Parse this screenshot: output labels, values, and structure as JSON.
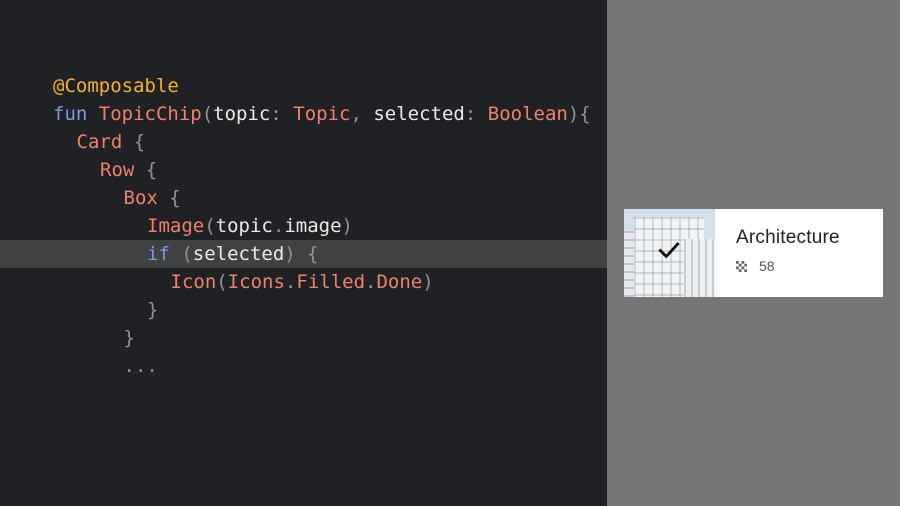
{
  "code": {
    "lines": [
      {
        "indent": 0,
        "tokens": [
          {
            "t": "@Composable",
            "c": "ann"
          }
        ]
      },
      {
        "indent": 0,
        "tokens": [
          {
            "t": "fun ",
            "c": "kw"
          },
          {
            "t": "TopicChip",
            "c": "fn"
          },
          {
            "t": "(",
            "c": "punc"
          },
          {
            "t": "topic",
            "c": "id"
          },
          {
            "t": ": ",
            "c": "punc"
          },
          {
            "t": "Topic",
            "c": "type"
          },
          {
            "t": ", ",
            "c": "punc"
          },
          {
            "t": "selected",
            "c": "id"
          },
          {
            "t": ": ",
            "c": "punc"
          },
          {
            "t": "Boolean",
            "c": "type"
          },
          {
            "t": "){",
            "c": "punc"
          }
        ]
      },
      {
        "indent": 1,
        "tokens": [
          {
            "t": "Card",
            "c": "fn"
          },
          {
            "t": " {",
            "c": "punc"
          }
        ]
      },
      {
        "indent": 2,
        "tokens": [
          {
            "t": "Row",
            "c": "fn"
          },
          {
            "t": " {",
            "c": "punc"
          }
        ]
      },
      {
        "indent": 3,
        "tokens": [
          {
            "t": "Box",
            "c": "fn"
          },
          {
            "t": " {",
            "c": "punc"
          }
        ]
      },
      {
        "indent": 4,
        "tokens": [
          {
            "t": "Image",
            "c": "fn"
          },
          {
            "t": "(",
            "c": "punc"
          },
          {
            "t": "topic",
            "c": "id"
          },
          {
            "t": ".",
            "c": "punc"
          },
          {
            "t": "image",
            "c": "id"
          },
          {
            "t": ")",
            "c": "punc"
          }
        ]
      },
      {
        "indent": 4,
        "highlight": true,
        "tokens": [
          {
            "t": "if",
            "c": "kw"
          },
          {
            "t": " (",
            "c": "punc"
          },
          {
            "t": "selected",
            "c": "id"
          },
          {
            "t": ") {",
            "c": "punc"
          }
        ]
      },
      {
        "indent": 5,
        "tokens": [
          {
            "t": "Icon",
            "c": "fn"
          },
          {
            "t": "(",
            "c": "punc"
          },
          {
            "t": "Icons",
            "c": "type"
          },
          {
            "t": ".",
            "c": "punc"
          },
          {
            "t": "Filled",
            "c": "type"
          },
          {
            "t": ".",
            "c": "punc"
          },
          {
            "t": "Done",
            "c": "type"
          },
          {
            "t": ")",
            "c": "punc"
          }
        ]
      },
      {
        "indent": 4,
        "tokens": [
          {
            "t": "}",
            "c": "punc"
          }
        ]
      },
      {
        "indent": 3,
        "tokens": [
          {
            "t": "}",
            "c": "punc"
          }
        ]
      },
      {
        "indent": 3,
        "tokens": [
          {
            "t": "...",
            "c": "punc"
          }
        ]
      }
    ]
  },
  "preview": {
    "chip": {
      "title": "Architecture",
      "count": "58",
      "selected": true,
      "selected_icon": "check-icon",
      "count_icon": "grid-icon",
      "image": "building-photo"
    }
  },
  "colors": {
    "editor_bg": "#202124",
    "highlight_bg": "#404143",
    "annotation": "#f2b224",
    "keyword": "#7a9cd9",
    "function": "#ee8268",
    "identifier": "#eaeaea",
    "punctuation": "#8f949b",
    "preview_bg": "#767676",
    "card_bg": "#ffffff"
  }
}
